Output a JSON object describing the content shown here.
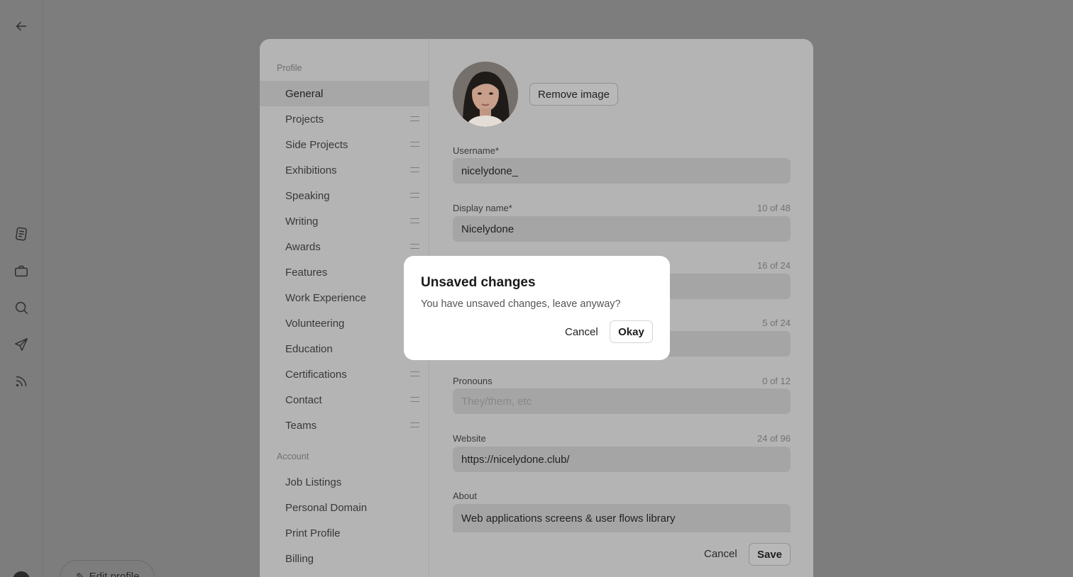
{
  "rail": {
    "icons": [
      "back-arrow-icon",
      "document-icon",
      "briefcase-icon",
      "search-icon",
      "send-icon",
      "rss-icon"
    ],
    "edit_profile_label": "Edit profile"
  },
  "sidebar": {
    "profile_heading": "Profile",
    "profile_items": [
      {
        "label": "General",
        "active": true,
        "draggable": false
      },
      {
        "label": "Projects",
        "draggable": true
      },
      {
        "label": "Side Projects",
        "draggable": true
      },
      {
        "label": "Exhibitions",
        "draggable": true
      },
      {
        "label": "Speaking",
        "draggable": true
      },
      {
        "label": "Writing",
        "draggable": true
      },
      {
        "label": "Awards",
        "draggable": true
      },
      {
        "label": "Features",
        "draggable": true
      },
      {
        "label": "Work Experience",
        "draggable": true
      },
      {
        "label": "Volunteering",
        "draggable": true
      },
      {
        "label": "Education",
        "draggable": true
      },
      {
        "label": "Certifications",
        "draggable": true
      },
      {
        "label": "Contact",
        "draggable": true
      },
      {
        "label": "Teams",
        "draggable": true
      }
    ],
    "account_heading": "Account",
    "account_items": [
      {
        "label": "Job Listings"
      },
      {
        "label": "Personal Domain"
      },
      {
        "label": "Print Profile"
      },
      {
        "label": "Billing"
      }
    ]
  },
  "general": {
    "remove_image_label": "Remove image",
    "username": {
      "label": "Username*",
      "value": "nicelydone_"
    },
    "display_name": {
      "label": "Display name*",
      "count": "10 of 48",
      "value": "Nicelydone"
    },
    "hidden_field_1": {
      "count": "16 of 24",
      "value": ""
    },
    "hidden_field_2": {
      "count": "5 of 24",
      "value": ""
    },
    "pronouns": {
      "label": "Pronouns",
      "count": "0 of 12",
      "placeholder": "They/them, etc"
    },
    "website": {
      "label": "Website",
      "count": "24 of 96",
      "value": "https://nicelydone.club/"
    },
    "about": {
      "label": "About",
      "value": "Web applications screens & user flows library"
    },
    "cancel_label": "Cancel",
    "save_label": "Save"
  },
  "dialog": {
    "title": "Unsaved changes",
    "message": "You have unsaved changes, leave anyway?",
    "cancel_label": "Cancel",
    "okay_label": "Okay"
  },
  "colors": {
    "overlay": "#7d7d7d",
    "panel": "#b4b4b4",
    "dialog": "#ffffff"
  }
}
